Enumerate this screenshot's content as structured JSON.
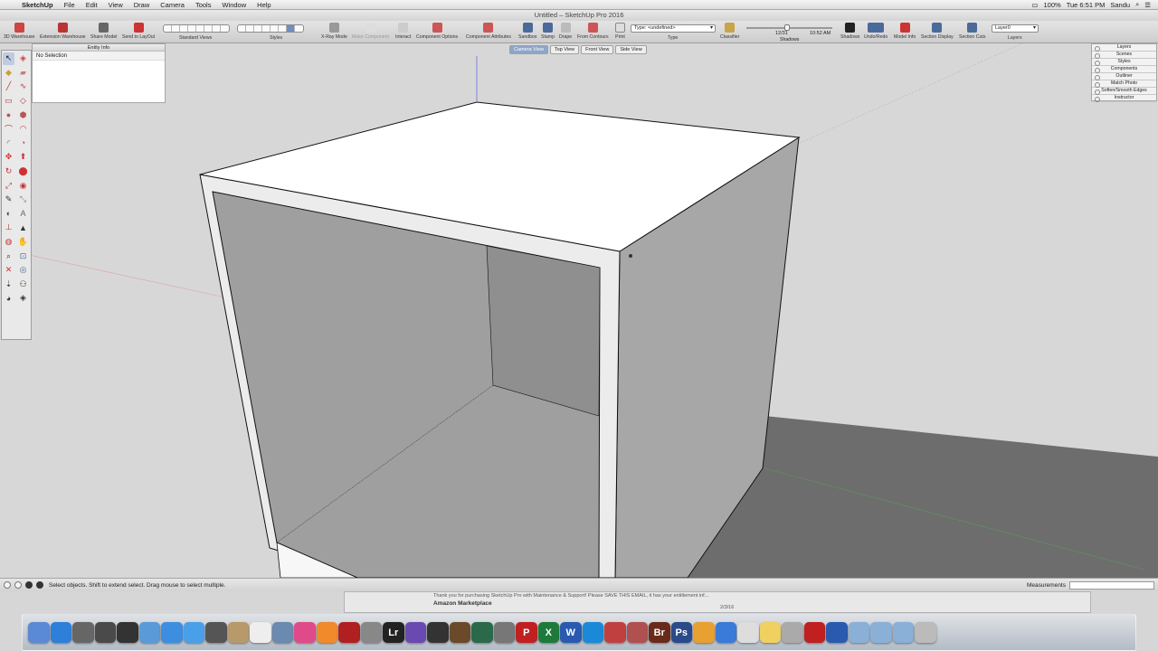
{
  "menubar": {
    "items": [
      "SketchUp",
      "File",
      "Edit",
      "View",
      "Draw",
      "Camera",
      "Tools",
      "Window",
      "Help"
    ],
    "clock": "Tue 6:51 PM",
    "user": "Sandu",
    "battery": "100%"
  },
  "window": {
    "title": "Untitled – SketchUp Pro 2016"
  },
  "toolbar": {
    "labels": {
      "warehouse": "3D Warehouse",
      "ext_warehouse": "Extension Warehouse",
      "share_model": "Share Model",
      "send_layout": "Send to LayOut",
      "standard_views": "Standard Views",
      "styles": "Styles",
      "xray": "X-Ray Mode",
      "make_component": "Make Component",
      "interact": "Interact",
      "component_options": "Component Options",
      "component_attributes": "Component Attributes",
      "sandbox_sandbox": "Sandbox",
      "sandbox_stamp": "Stamp",
      "sandbox_drape": "Drape",
      "from_contours": "From Contours",
      "print": "Print",
      "type": "Type",
      "classifier": "Classifier",
      "shadows_slider": "Shadows",
      "shadows": "Shadows",
      "undo_redo": "Undo/Redo",
      "model_info": "Model Info",
      "section_display": "Section Display",
      "section_cuts": "Section Cuts",
      "layers": "Layers"
    },
    "type_value": "Type: <undefined>",
    "layer_value": "Layer0",
    "shadow_date": "12/31",
    "shadow_time": "10:52 AM"
  },
  "view_tabs": [
    "Camera View",
    "Top View",
    "Front View",
    "Side View"
  ],
  "entity_info": {
    "title": "Entity Info",
    "selection": "No Selection"
  },
  "trays": [
    "Layers",
    "Scenes",
    "Styles",
    "Components",
    "Outliner",
    "Match Photo",
    "Soften/Smooth Edges",
    "Instructor"
  ],
  "status": {
    "message": "Select objects. Shift to extend select. Drag mouse to select multiple.",
    "measurements_label": "Measurements"
  },
  "background_window": {
    "line1": "Thank you for purchasing SketchUp Pro with Maintenance & Support! Please SAVE THIS EMAIL, it has your entitlement inf...",
    "line2": "Amazon Marketplace",
    "date": "2/3/16"
  },
  "dock_icons": [
    "finder-icon",
    "appstore-icon",
    "calculator-icon",
    "launchpad-icon",
    "mission-control-icon",
    "preview-icon",
    "safari-icon",
    "messages-icon",
    "facetime-icon",
    "contacts-icon",
    "calendar-icon",
    "photos-icon",
    "itunes-icon",
    "ibooks-icon",
    "photo-booth-icon",
    "chess-icon",
    "lightroom-icon",
    "imovie-icon",
    "unity-icon",
    "guitar-icon",
    "time-machine-icon",
    "system-prefs-icon",
    "pinterest-icon",
    "excel-icon",
    "word-icon",
    "skype-icon",
    "sketchup-layout-icon",
    "sketchup-style-icon",
    "bridge-icon",
    "photoshop-icon",
    "pages-icon",
    "keynote-icon",
    "textedit-icon",
    "notes-icon",
    "disk-icon",
    "sketchup-icon",
    "quicktime-icon",
    "folder-1-icon",
    "folder-2-icon",
    "folder-3-icon",
    "trash-icon"
  ],
  "colors": {
    "sky": "#d7d7d7",
    "ground": "#6d6d6d",
    "top_face": "#ffffff",
    "side_face": "#a7a7a7",
    "inner_face": "#9f9f9f",
    "accent": "#6c8fbf"
  }
}
